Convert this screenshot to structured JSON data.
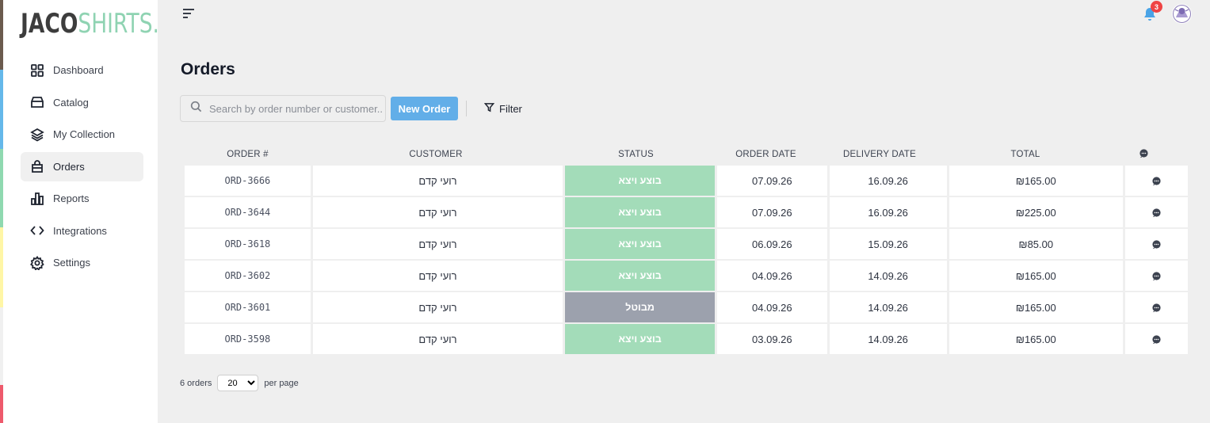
{
  "colors": {
    "strip": [
      "#6b5b4e",
      "#65b8ea",
      "#8fd9b0",
      "#fff6a6",
      "#f0f0f0",
      "#ee5a6c"
    ],
    "logo_dark": "#3d3d3d",
    "logo_accent": "#8fd3b2",
    "primary_button": "#62aee8",
    "status_success": "#a3dcb9",
    "status_cancelled": "#9ca1ad",
    "badge": "#ef4444"
  },
  "logo": {
    "part1": "JACO",
    "part2": "SHIRTS."
  },
  "sidebar": {
    "items": [
      {
        "label": "Dashboard",
        "icon": "grid-icon",
        "active": false
      },
      {
        "label": "Catalog",
        "icon": "box-icon",
        "active": false
      },
      {
        "label": "My Collection",
        "icon": "layers-icon",
        "active": false
      },
      {
        "label": "Orders",
        "icon": "bag-icon",
        "active": true
      },
      {
        "label": "Reports",
        "icon": "chart-icon",
        "active": false
      },
      {
        "label": "Integrations",
        "icon": "code-icon",
        "active": false
      },
      {
        "label": "Settings",
        "icon": "gear-icon",
        "active": false
      }
    ]
  },
  "header": {
    "notification_count": "3",
    "avatar": "avatar-icon"
  },
  "page": {
    "title": "Orders"
  },
  "toolbar": {
    "search_placeholder": "Search by order number or customer...",
    "search_value": "",
    "new_order_label": "New Order",
    "filter_label": "Filter"
  },
  "table": {
    "columns": [
      "ORDER #",
      "CUSTOMER",
      "STATUS",
      "ORDER DATE",
      "DELIVERY DATE",
      "TOTAL"
    ],
    "rows": [
      {
        "order": "ORD-3666",
        "customer": "רועי קדם",
        "status": "בוצע ויצא",
        "status_type": "success",
        "order_date": "07.09.26",
        "delivery_date": "16.09.26",
        "total": "₪165.00"
      },
      {
        "order": "ORD-3644",
        "customer": "רועי קדם",
        "status": "בוצע ויצא",
        "status_type": "success",
        "order_date": "07.09.26",
        "delivery_date": "16.09.26",
        "total": "₪225.00"
      },
      {
        "order": "ORD-3618",
        "customer": "רועי קדם",
        "status": "בוצע ויצא",
        "status_type": "success",
        "order_date": "06.09.26",
        "delivery_date": "15.09.26",
        "total": "₪85.00"
      },
      {
        "order": "ORD-3602",
        "customer": "רועי קדם",
        "status": "בוצע ויצא",
        "status_type": "success",
        "order_date": "04.09.26",
        "delivery_date": "14.09.26",
        "total": "₪165.00"
      },
      {
        "order": "ORD-3601",
        "customer": "רועי קדם",
        "status": "מבוטל",
        "status_type": "cancelled",
        "order_date": "04.09.26",
        "delivery_date": "14.09.26",
        "total": "₪165.00"
      },
      {
        "order": "ORD-3598",
        "customer": "רועי קדם",
        "status": "בוצע ויצא",
        "status_type": "success",
        "order_date": "03.09.26",
        "delivery_date": "14.09.26",
        "total": "₪165.00"
      }
    ]
  },
  "footer": {
    "count_label": "6 orders",
    "page_size": "20",
    "page_size_options": [
      "20"
    ],
    "per_page_label": "per page"
  }
}
